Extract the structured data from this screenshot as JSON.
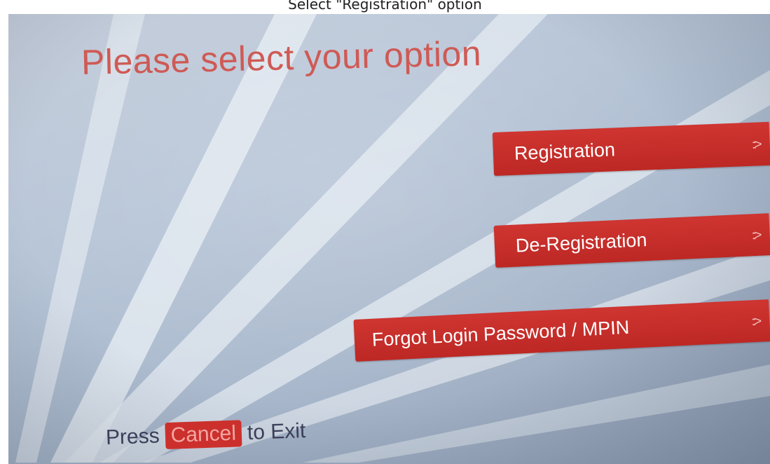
{
  "caption": "Select \"Registration\" option",
  "screen": {
    "headline": "Please select your option",
    "options": [
      {
        "label": "Registration",
        "arrow": "::>"
      },
      {
        "label": "De-Registration",
        "arrow": "::>"
      },
      {
        "label": "Forgot Login Password / MPIN",
        "arrow": "::>"
      }
    ],
    "footer": {
      "prefix": "Press",
      "key": "Cancel",
      "suffix": "to Exit"
    }
  },
  "colors": {
    "button_red": "#c52e2a",
    "headline_red": "#cf5a55",
    "footer_text": "#3b3f59",
    "screen_blue": "#b8c6d8"
  }
}
